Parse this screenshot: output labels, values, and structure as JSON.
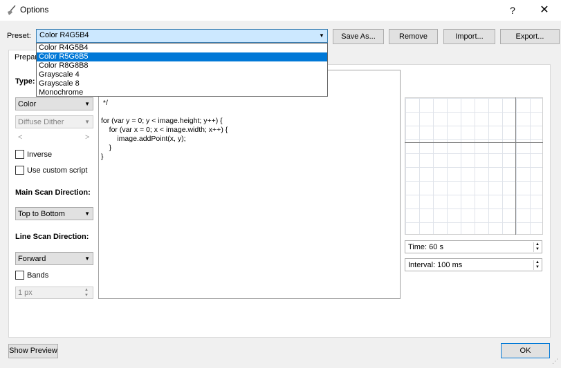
{
  "window": {
    "title": "Options",
    "help": "?",
    "close": "✕"
  },
  "preset": {
    "label": "Preset:",
    "value": "Color R4G5B4",
    "options": [
      "Color R4G5B4",
      "Color R5G6B5",
      "Color R8G8B8",
      "Grayscale 4",
      "Grayscale 8",
      "Monochrome"
    ],
    "selected_index": 1
  },
  "buttons": {
    "save_as": "Save As...",
    "remove": "Remove",
    "import": "Import...",
    "export": "Export...",
    "show_preview": "Show Preview",
    "ok": "OK"
  },
  "tab": {
    "label": "Prepar"
  },
  "left": {
    "type_label": "Type:",
    "type_value": "Color",
    "dither_value": "Diffuse Dither",
    "inverse_label": "Inverse",
    "custom_script_label": "Use custom script",
    "main_scan_label": "Main Scan Direction:",
    "main_scan_value": "Top to Bottom",
    "line_scan_label": "Line Scan Direction:",
    "line_scan_value": "Forward",
    "bands_label": "Bands",
    "bands_value": "1 px"
  },
  "editor": {
    "code": "    forward\n */\n\nfor (var y = 0; y < image.height; y++) {\n    for (var x = 0; x < image.width; x++) {\n        image.addPoint(x, y);\n    }\n}"
  },
  "right": {
    "time": "Time: 60 s",
    "interval": "Interval: 100 ms"
  },
  "colors": {
    "accent": "#0078d7",
    "combo_highlight": "#cce8ff"
  }
}
